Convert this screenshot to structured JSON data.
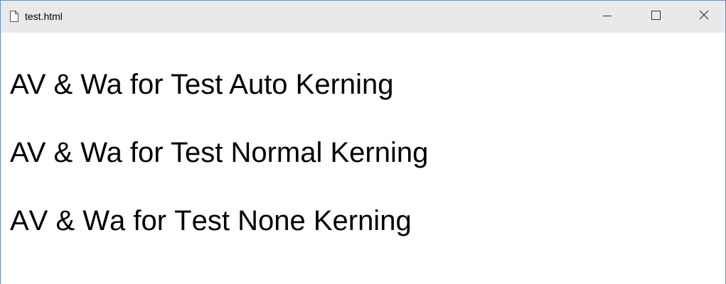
{
  "window": {
    "title": "test.html",
    "icons": {
      "document": "document-icon",
      "minimize": "minimize-icon",
      "maximize": "maximize-icon",
      "close": "close-icon"
    }
  },
  "content": {
    "lines": [
      "AV & Wa for Test Auto Kerning",
      "AV & Wa for Test Normal Kerning",
      "AV & Wa for Test None Kerning"
    ]
  }
}
